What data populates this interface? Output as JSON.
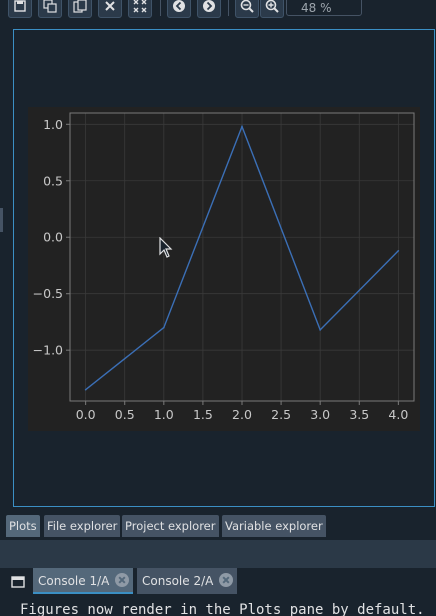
{
  "toolbar": {
    "buttons": [
      {
        "name": "save-icon"
      },
      {
        "name": "save-all-icon"
      },
      {
        "name": "copy-icon"
      },
      {
        "name": "close-icon"
      },
      {
        "name": "close-all-icon"
      },
      {
        "name": "previous-icon"
      },
      {
        "name": "next-icon"
      },
      {
        "name": "zoom-out-icon"
      },
      {
        "name": "zoom-in-icon"
      }
    ],
    "zoom_value": "48 %"
  },
  "chart_data": {
    "type": "line",
    "x": [
      0,
      1,
      2,
      3,
      4
    ],
    "series": [
      {
        "values": [
          -1.35,
          -0.8,
          0.98,
          -0.82,
          -0.12
        ],
        "color": "#3b6fb6"
      }
    ],
    "xticks": [
      "0.0",
      "0.5",
      "1.0",
      "1.5",
      "2.0",
      "2.5",
      "3.0",
      "3.5",
      "4.0"
    ],
    "yticks": [
      "−1.0",
      "−0.5",
      "0.0",
      "0.5",
      "1.0"
    ],
    "xlim": [
      -0.2,
      4.2
    ],
    "ylim": [
      -1.45,
      1.1
    ],
    "grid": true,
    "colors": {
      "figure_bg": "#222222",
      "axes_bg": "#222222",
      "spine": "#7a7a7a",
      "grid": "#3a3a3a",
      "tick_text": "#c8c8c8"
    }
  },
  "pane_tabs": [
    {
      "label": "Plots",
      "active": true
    },
    {
      "label": "File explorer",
      "active": false
    },
    {
      "label": "Project explorer",
      "active": false
    },
    {
      "label": "Variable explorer",
      "active": false
    }
  ],
  "console_tabs": [
    {
      "label": "Console 1/A",
      "active": true
    },
    {
      "label": "Console 2/A",
      "active": false
    }
  ],
  "console_output": "Figures now render in the Plots pane by default."
}
